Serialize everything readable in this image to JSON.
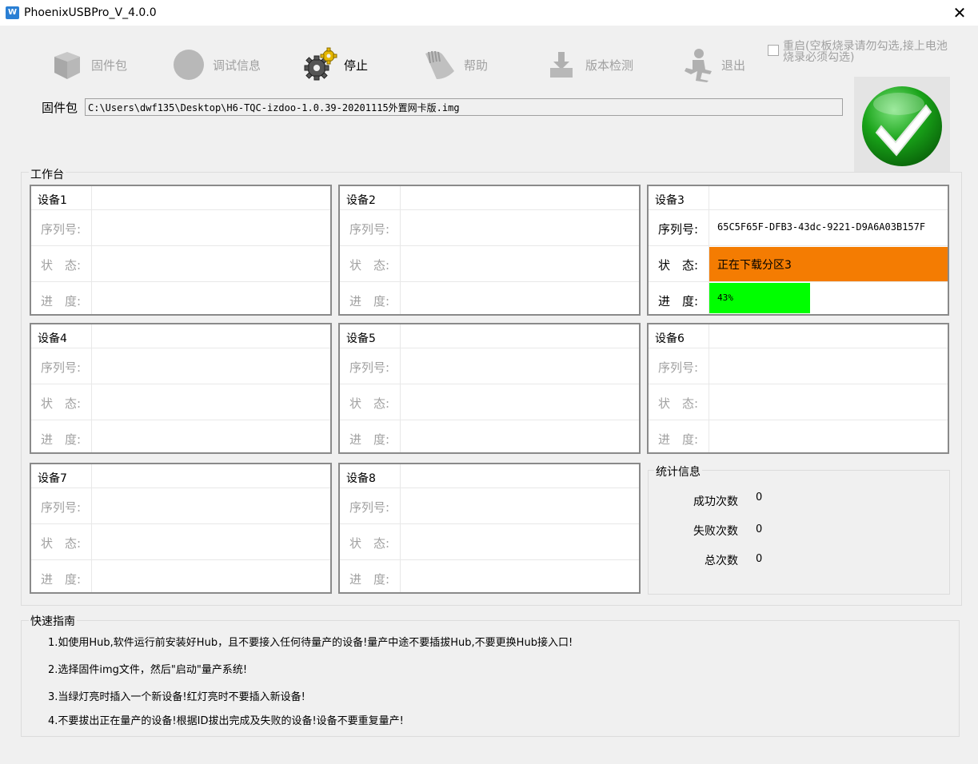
{
  "window": {
    "title": "PhoenixUSBPro_V_4.0.0",
    "app_icon_text": "W"
  },
  "toolbar": {
    "firmware": "固件包",
    "debug": "调试信息",
    "stop": "停止",
    "help": "帮助",
    "version_check": "版本检测",
    "exit": "退出"
  },
  "reboot": {
    "label": "重启(空板烧录请勿勾选,接上电池烧录必须勾选)",
    "checked": false
  },
  "firmware": {
    "label": "固件包",
    "path": "C:\\Users\\dwf135\\Desktop\\H6-TQC-izdoo-1.0.39-20201115外置网卡版.img"
  },
  "status_indicator": "success-check",
  "workbench": {
    "title": "工作台",
    "labels": {
      "serial": "序列号:",
      "state": "状　态:",
      "progress": "进　度:"
    },
    "labels_active": {
      "serial": "序列号:",
      "state": "状　态:",
      "progress": "进　度:"
    },
    "devices": [
      {
        "name": "设备1"
      },
      {
        "name": "设备2"
      },
      {
        "name": "设备3",
        "serial": "65C5F65F-DFB3-43dc-9221-D9A6A03B157F",
        "state": "正在下载分区3",
        "progress": "43%",
        "progress_value": 43
      },
      {
        "name": "设备4"
      },
      {
        "name": "设备5"
      },
      {
        "name": "设备6"
      },
      {
        "name": "设备7"
      },
      {
        "name": "设备8"
      }
    ]
  },
  "stats": {
    "title": "统计信息",
    "success_label": "成功次数",
    "success": "0",
    "fail_label": "失败次数",
    "fail": "0",
    "total_label": "总次数",
    "total": "0"
  },
  "guide": {
    "title": "快速指南",
    "items": [
      "1.如使用Hub,软件运行前安装好Hub，且不要接入任何待量产的设备!量产中途不要插拔Hub,不要更换Hub接入口!",
      "2.选择固件img文件，然后\"启动\"量产系统!",
      "3.当绿灯亮时插入一个新设备!红灯亮时不要插入新设备!",
      "4.不要拔出正在量产的设备!根据ID拔出完成及失败的设备!设备不要重复量产!"
    ]
  },
  "colors": {
    "state_bar": "#f47c02",
    "progress_bar": "#00ff00",
    "check_green": "#19a319"
  }
}
